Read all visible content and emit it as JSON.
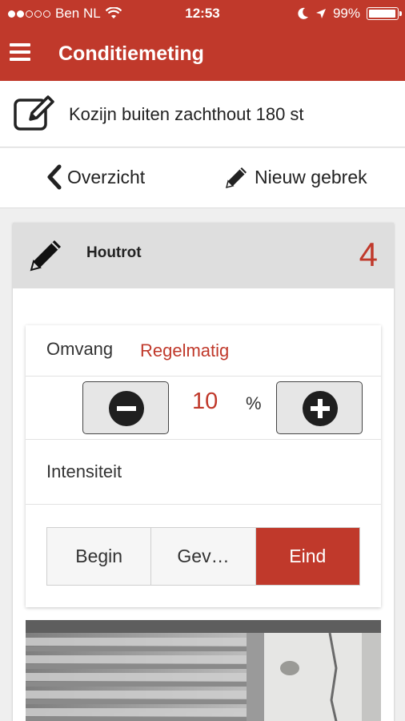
{
  "status": {
    "carrier": "Ben NL",
    "time": "12:53",
    "battery": "99%"
  },
  "header": {
    "title": "Conditiemeting"
  },
  "object": {
    "title": "Kozijn buiten zachthout  180 st"
  },
  "nav": {
    "back_label": "Overzicht",
    "new_label": "Nieuw gebrek"
  },
  "defect": {
    "name": "Houtrot",
    "score": "4",
    "omvang_label": "Omvang",
    "omvang_value": "Regelmatig",
    "percentage": "10",
    "unit": "%",
    "intensiteit_label": "Intensiteit",
    "intensity_options": [
      "Begin",
      "Gev…",
      "Eind"
    ],
    "intensity_selected": "Eind"
  },
  "colors": {
    "accent": "#c0392b",
    "header_gray": "#dedede"
  }
}
